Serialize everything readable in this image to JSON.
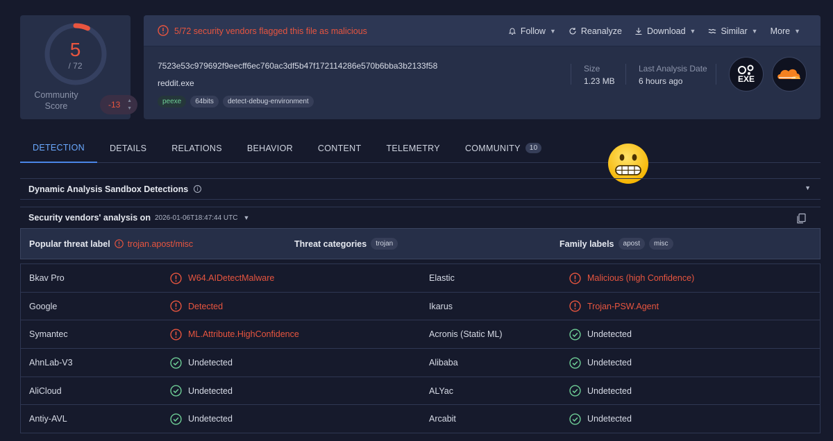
{
  "score": {
    "detections": "5",
    "total": "/ 72",
    "community_label": "Community Score",
    "community_value": "-13"
  },
  "header": {
    "alert": "5/72 security vendors flagged this file as malicious",
    "actions": [
      "Follow",
      "Reanalyze",
      "Download",
      "Similar",
      "More"
    ],
    "hash": "7523e53c979692f9eecff6ec760ac3df5b47f172114286e570b6bba3b2133f58",
    "filename": "reddit.exe",
    "tags": [
      "peexe",
      "64bits",
      "detect-debug-environment"
    ],
    "size_label": "Size",
    "size_value": "1.23 MB",
    "last_analysis_label": "Last Analysis Date",
    "last_analysis_value": "6 hours ago",
    "file_type_icon": "EXE"
  },
  "tabs": [
    {
      "label": "DETECTION",
      "active": true
    },
    {
      "label": "DETAILS"
    },
    {
      "label": "RELATIONS"
    },
    {
      "label": "BEHAVIOR"
    },
    {
      "label": "CONTENT"
    },
    {
      "label": "TELEMETRY"
    },
    {
      "label": "COMMUNITY",
      "count": "10"
    }
  ],
  "sandbox": {
    "title": "Dynamic Analysis Sandbox Detections"
  },
  "vendors": {
    "title": "Security vendors' analysis on",
    "date": "2026-01-06T18:47:44 UTC"
  },
  "labels": {
    "popular_key": "Popular threat label",
    "popular_value": "trojan.apost/misc",
    "categories_key": "Threat categories",
    "categories": [
      "trojan"
    ],
    "family_key": "Family labels",
    "family": [
      "apost",
      "misc"
    ]
  },
  "rows": [
    {
      "v1": "Bkav Pro",
      "r1": "W64.AIDetectMalware",
      "s1": "bad",
      "v2": "Elastic",
      "r2": "Malicious (high Confidence)",
      "s2": "bad"
    },
    {
      "v1": "Google",
      "r1": "Detected",
      "s1": "bad",
      "v2": "Ikarus",
      "r2": "Trojan-PSW.Agent",
      "s2": "bad"
    },
    {
      "v1": "Symantec",
      "r1": "ML.Attribute.HighConfidence",
      "s1": "bad",
      "v2": "Acronis (Static ML)",
      "r2": "Undetected",
      "s2": "ok"
    },
    {
      "v1": "AhnLab-V3",
      "r1": "Undetected",
      "s1": "ok",
      "v2": "Alibaba",
      "r2": "Undetected",
      "s2": "ok"
    },
    {
      "v1": "AliCloud",
      "r1": "Undetected",
      "s1": "ok",
      "v2": "ALYac",
      "r2": "Undetected",
      "s2": "ok"
    },
    {
      "v1": "Antiy-AVL",
      "r1": "Undetected",
      "s1": "ok",
      "v2": "Arcabit",
      "r2": "Undetected",
      "s2": "ok"
    }
  ],
  "colors": {
    "malicious": "#e8553f",
    "clean": "#6fcf97",
    "accent": "#4a86e8",
    "bg": "#161a2c",
    "panel": "#262f48"
  }
}
